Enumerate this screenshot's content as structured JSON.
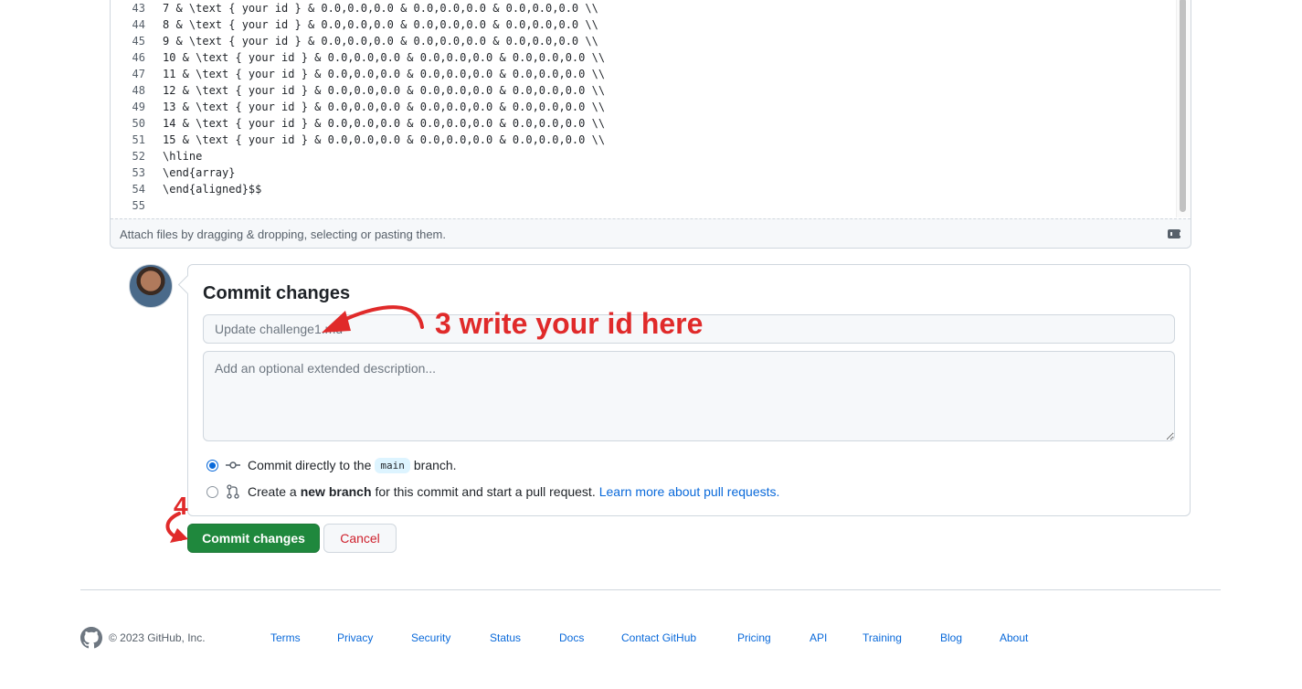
{
  "editor": {
    "lines": [
      {
        "num": "43",
        "text": "7 & \\text { your id } & 0.0,0.0,0.0 & 0.0,0.0,0.0 & 0.0,0.0,0.0 \\\\"
      },
      {
        "num": "44",
        "text": "8 & \\text { your id } & 0.0,0.0,0.0 & 0.0,0.0,0.0 & 0.0,0.0,0.0 \\\\"
      },
      {
        "num": "45",
        "text": "9 & \\text { your id } & 0.0,0.0,0.0 & 0.0,0.0,0.0 & 0.0,0.0,0.0 \\\\"
      },
      {
        "num": "46",
        "text": "10 & \\text { your id } & 0.0,0.0,0.0 & 0.0,0.0,0.0 & 0.0,0.0,0.0 \\\\"
      },
      {
        "num": "47",
        "text": "11 & \\text { your id } & 0.0,0.0,0.0 & 0.0,0.0,0.0 & 0.0,0.0,0.0 \\\\"
      },
      {
        "num": "48",
        "text": "12 & \\text { your id } & 0.0,0.0,0.0 & 0.0,0.0,0.0 & 0.0,0.0,0.0 \\\\"
      },
      {
        "num": "49",
        "text": "13 & \\text { your id } & 0.0,0.0,0.0 & 0.0,0.0,0.0 & 0.0,0.0,0.0 \\\\"
      },
      {
        "num": "50",
        "text": "14 & \\text { your id } & 0.0,0.0,0.0 & 0.0,0.0,0.0 & 0.0,0.0,0.0 \\\\"
      },
      {
        "num": "51",
        "text": "15 & \\text { your id } & 0.0,0.0,0.0 & 0.0,0.0,0.0 & 0.0,0.0,0.0 \\\\"
      },
      {
        "num": "52",
        "text": "\\hline"
      },
      {
        "num": "53",
        "text": "\\end{array}"
      },
      {
        "num": "54",
        "text": "\\end{aligned}$$"
      },
      {
        "num": "55",
        "text": ""
      }
    ],
    "attach_text": "Attach files by dragging & dropping, selecting or pasting them.",
    "markdown_icon": "markdown-icon"
  },
  "commit": {
    "title": "Commit changes",
    "summary_placeholder": "Update challenge1.md",
    "description_placeholder": "Add an optional extended description...",
    "option_direct": {
      "prefix": "Commit directly to the",
      "branch": "main",
      "suffix": "branch.",
      "checked": true
    },
    "option_new_branch": {
      "prefix": "Create a",
      "bold": "new branch",
      "suffix": "for this commit and start a pull request.",
      "link": "Learn more about pull requests.",
      "checked": false
    }
  },
  "buttons": {
    "commit_label": "Commit changes",
    "cancel_label": "Cancel"
  },
  "annotations": {
    "step3": "3 write your id here",
    "step4": "4",
    "color": "#e02a2a"
  },
  "footer": {
    "copyright": "© 2023 GitHub, Inc.",
    "links": [
      "Terms",
      "Privacy",
      "Security",
      "Status",
      "Docs",
      "Contact GitHub",
      "Pricing",
      "API",
      "Training",
      "Blog",
      "About"
    ]
  },
  "colors": {
    "primary_green": "#1f883d",
    "link_blue": "#0969da",
    "danger_red": "#cf222e",
    "border": "#d0d7de"
  }
}
